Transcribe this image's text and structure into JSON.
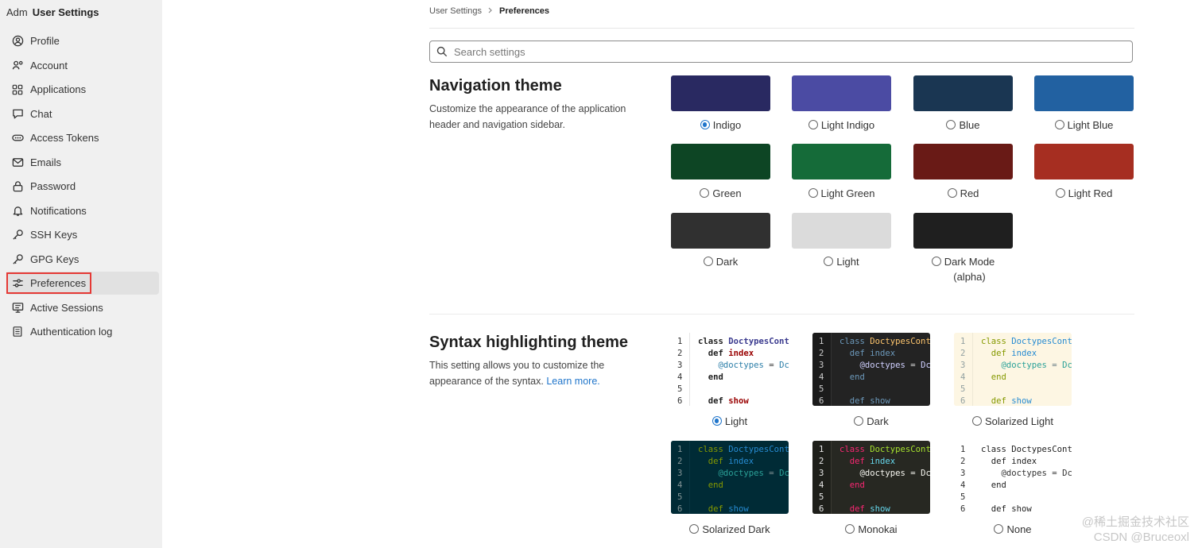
{
  "sidebar": {
    "org_abbrev": "Adm",
    "title": "User Settings",
    "items": [
      {
        "label": "Profile",
        "icon": "profile-icon"
      },
      {
        "label": "Account",
        "icon": "account-icon"
      },
      {
        "label": "Applications",
        "icon": "applications-icon"
      },
      {
        "label": "Chat",
        "icon": "chat-icon"
      },
      {
        "label": "Access Tokens",
        "icon": "token-icon"
      },
      {
        "label": "Emails",
        "icon": "mail-icon"
      },
      {
        "label": "Password",
        "icon": "lock-icon"
      },
      {
        "label": "Notifications",
        "icon": "bell-icon"
      },
      {
        "label": "SSH Keys",
        "icon": "key-icon"
      },
      {
        "label": "GPG Keys",
        "icon": "key-icon"
      },
      {
        "label": "Preferences",
        "icon": "preferences-icon",
        "active": true
      },
      {
        "label": "Active Sessions",
        "icon": "monitor-icon"
      },
      {
        "label": "Authentication log",
        "icon": "log-icon"
      }
    ]
  },
  "breadcrumb": {
    "parent": "User Settings",
    "current": "Preferences"
  },
  "search": {
    "placeholder": "Search settings"
  },
  "nav_theme": {
    "title": "Navigation theme",
    "description": "Customize the appearance of the application header and navigation sidebar.",
    "options": [
      {
        "label": "Indigo",
        "color": "#292961",
        "selected": true
      },
      {
        "label": "Light Indigo",
        "color": "#4b4ba3"
      },
      {
        "label": "Blue",
        "color": "#1a3652"
      },
      {
        "label": "Light Blue",
        "color": "#2261a1"
      },
      {
        "label": "Green",
        "color": "#0d4524"
      },
      {
        "label": "Light Green",
        "color": "#156b39"
      },
      {
        "label": "Red",
        "color": "#691a16"
      },
      {
        "label": "Light Red",
        "color": "#a62e21"
      },
      {
        "label": "Dark",
        "color": "#303030"
      },
      {
        "label": "Light",
        "color": "#dbdbdb"
      },
      {
        "label": "Dark Mode",
        "label_line2": "(alpha)",
        "color": "#1f1f1f"
      }
    ]
  },
  "syntax_theme": {
    "title": "Syntax highlighting theme",
    "description": "This setting allows you to customize the appearance of the syntax.",
    "learn_more": "Learn more.",
    "code_lines": {
      "line_numbers": [
        "1",
        "2",
        "3",
        "4",
        "5",
        "6"
      ],
      "class_kw": "class",
      "class_name": "DoctypesCont",
      "def_kw": "def",
      "method1": "index",
      "ivar": "@doctypes",
      "assign": " = ",
      "const": "Dc",
      "end_kw": "end",
      "method2": "show"
    },
    "options": [
      {
        "label": "Light",
        "selected": true
      },
      {
        "label": "Dark"
      },
      {
        "label": "Solarized Light"
      },
      {
        "label": "Solarized Dark"
      },
      {
        "label": "Monokai"
      },
      {
        "label": "None"
      }
    ]
  },
  "watermark": {
    "line1": "@稀土掘金技术社区",
    "line2": "CSDN @Bruceoxl"
  }
}
